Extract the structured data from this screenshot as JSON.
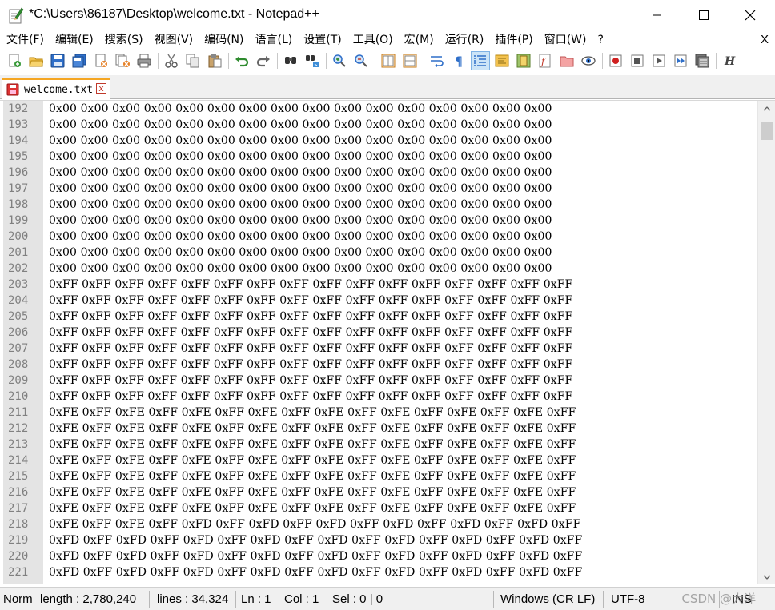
{
  "window": {
    "title": "*C:\\Users\\86187\\Desktop\\welcome.txt - Notepad++",
    "app_icon": "notepad-plus-plus-icon",
    "controls": [
      "minimize-icon",
      "maximize-icon",
      "close-icon"
    ]
  },
  "menu": {
    "items": [
      "文件(F)",
      "编辑(E)",
      "搜索(S)",
      "视图(V)",
      "编码(N)",
      "语言(L)",
      "设置(T)",
      "工具(O)",
      "宏(M)",
      "运行(R)",
      "插件(P)",
      "窗口(W)",
      "?"
    ],
    "close_label": "X"
  },
  "toolbar": {
    "buttons": [
      "new-file-icon",
      "open-file-icon",
      "save-icon",
      "save-all-icon",
      "close-icon",
      "close-all-icon",
      "print-icon",
      "cut-icon",
      "copy-icon",
      "paste-icon",
      "undo-icon",
      "redo-icon",
      "find-icon",
      "replace-icon",
      "zoom-in-icon",
      "zoom-out-icon",
      "sync-vertical-icon",
      "sync-horizontal-icon",
      "word-wrap-icon",
      "show-all-chars-icon",
      "indent-guide-icon",
      "user-defined-language-icon",
      "document-map-icon",
      "function-list-icon",
      "folder-as-workspace-icon",
      "monitoring-icon",
      "record-macro-icon",
      "stop-macro-icon",
      "play-macro-icon",
      "run-macro-multiple-icon",
      "save-macro-icon",
      "hex-editor-icon"
    ]
  },
  "tab": {
    "label": "welcome.txt",
    "close_label": "x",
    "accent_color": "#f5a623"
  },
  "editor": {
    "line_numbers": [
      "192",
      "193",
      "194",
      "195",
      "196",
      "197",
      "198",
      "199",
      "200",
      "201",
      "202",
      "203",
      "204",
      "205",
      "206",
      "207",
      "208",
      "209",
      "210",
      "211",
      "212",
      "213",
      "214",
      "215",
      "216",
      "217",
      "218",
      "219",
      "220",
      "221"
    ],
    "lines": [
      "0x00 0x00 0x00 0x00 0x00 0x00 0x00 0x00 0x00 0x00 0x00 0x00 0x00 0x00 0x00 0x00",
      "0x00 0x00 0x00 0x00 0x00 0x00 0x00 0x00 0x00 0x00 0x00 0x00 0x00 0x00 0x00 0x00",
      "0x00 0x00 0x00 0x00 0x00 0x00 0x00 0x00 0x00 0x00 0x00 0x00 0x00 0x00 0x00 0x00",
      "0x00 0x00 0x00 0x00 0x00 0x00 0x00 0x00 0x00 0x00 0x00 0x00 0x00 0x00 0x00 0x00",
      "0x00 0x00 0x00 0x00 0x00 0x00 0x00 0x00 0x00 0x00 0x00 0x00 0x00 0x00 0x00 0x00",
      "0x00 0x00 0x00 0x00 0x00 0x00 0x00 0x00 0x00 0x00 0x00 0x00 0x00 0x00 0x00 0x00",
      "0x00 0x00 0x00 0x00 0x00 0x00 0x00 0x00 0x00 0x00 0x00 0x00 0x00 0x00 0x00 0x00",
      "0x00 0x00 0x00 0x00 0x00 0x00 0x00 0x00 0x00 0x00 0x00 0x00 0x00 0x00 0x00 0x00",
      "0x00 0x00 0x00 0x00 0x00 0x00 0x00 0x00 0x00 0x00 0x00 0x00 0x00 0x00 0x00 0x00",
      "0x00 0x00 0x00 0x00 0x00 0x00 0x00 0x00 0x00 0x00 0x00 0x00 0x00 0x00 0x00 0x00",
      "0x00 0x00 0x00 0x00 0x00 0x00 0x00 0x00 0x00 0x00 0x00 0x00 0x00 0x00 0x00 0x00",
      "0xFF 0xFF 0xFF 0xFF 0xFF 0xFF 0xFF 0xFF 0xFF 0xFF 0xFF 0xFF 0xFF 0xFF 0xFF 0xFF",
      "0xFF 0xFF 0xFF 0xFF 0xFF 0xFF 0xFF 0xFF 0xFF 0xFF 0xFF 0xFF 0xFF 0xFF 0xFF 0xFF",
      "0xFF 0xFF 0xFF 0xFF 0xFF 0xFF 0xFF 0xFF 0xFF 0xFF 0xFF 0xFF 0xFF 0xFF 0xFF 0xFF",
      "0xFF 0xFF 0xFF 0xFF 0xFF 0xFF 0xFF 0xFF 0xFF 0xFF 0xFF 0xFF 0xFF 0xFF 0xFF 0xFF",
      "0xFF 0xFF 0xFF 0xFF 0xFF 0xFF 0xFF 0xFF 0xFF 0xFF 0xFF 0xFF 0xFF 0xFF 0xFF 0xFF",
      "0xFF 0xFF 0xFF 0xFF 0xFF 0xFF 0xFF 0xFF 0xFF 0xFF 0xFF 0xFF 0xFF 0xFF 0xFF 0xFF",
      "0xFF 0xFF 0xFF 0xFF 0xFF 0xFF 0xFF 0xFF 0xFF 0xFF 0xFF 0xFF 0xFF 0xFF 0xFF 0xFF",
      "0xFF 0xFF 0xFF 0xFF 0xFF 0xFF 0xFF 0xFF 0xFF 0xFF 0xFF 0xFF 0xFF 0xFF 0xFF 0xFF",
      "0xFE 0xFF 0xFE 0xFF 0xFE 0xFF 0xFE 0xFF 0xFE 0xFF 0xFE 0xFF 0xFE 0xFF 0xFE 0xFF",
      "0xFE 0xFF 0xFE 0xFF 0xFE 0xFF 0xFE 0xFF 0xFE 0xFF 0xFE 0xFF 0xFE 0xFF 0xFE 0xFF",
      "0xFE 0xFF 0xFE 0xFF 0xFE 0xFF 0xFE 0xFF 0xFE 0xFF 0xFE 0xFF 0xFE 0xFF 0xFE 0xFF",
      "0xFE 0xFF 0xFE 0xFF 0xFE 0xFF 0xFE 0xFF 0xFE 0xFF 0xFE 0xFF 0xFE 0xFF 0xFE 0xFF",
      "0xFE 0xFF 0xFE 0xFF 0xFE 0xFF 0xFE 0xFF 0xFE 0xFF 0xFE 0xFF 0xFE 0xFF 0xFE 0xFF",
      "0xFE 0xFF 0xFE 0xFF 0xFE 0xFF 0xFE 0xFF 0xFE 0xFF 0xFE 0xFF 0xFE 0xFF 0xFE 0xFF",
      "0xFE 0xFF 0xFE 0xFF 0xFE 0xFF 0xFE 0xFF 0xFE 0xFF 0xFE 0xFF 0xFE 0xFF 0xFE 0xFF",
      "0xFE 0xFF 0xFE 0xFF 0xFD 0xFF 0xFD 0xFF 0xFD 0xFF 0xFD 0xFF 0xFD 0xFF 0xFD 0xFF",
      "0xFD 0xFF 0xFD 0xFF 0xFD 0xFF 0xFD 0xFF 0xFD 0xFF 0xFD 0xFF 0xFD 0xFF 0xFD 0xFF",
      "0xFD 0xFF 0xFD 0xFF 0xFD 0xFF 0xFD 0xFF 0xFD 0xFF 0xFD 0xFF 0xFD 0xFF 0xFD 0xFF",
      "0xFD 0xFF 0xFD 0xFF 0xFD 0xFF 0xFD 0xFF 0xFD 0xFF 0xFD 0xFF 0xFD 0xFF 0xFD 0xFF"
    ],
    "scrollbar_position": 0.005
  },
  "statusbar": {
    "doc_type": "Norm",
    "length": "length : 2,780,240",
    "lines": "lines : 34,324",
    "ln": "Ln : 1",
    "col": "Col : 1",
    "sel": "Sel : 0 | 0",
    "eol": "Windows (CR LF)",
    "encoding": "UTF-8",
    "mode": "INS",
    "watermark": "CSDN @大洋"
  }
}
